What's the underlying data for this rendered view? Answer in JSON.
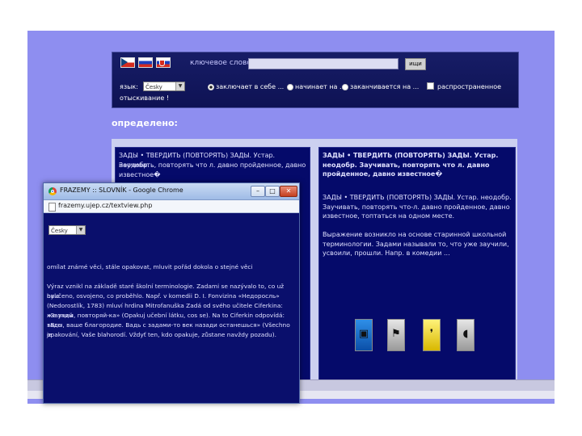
{
  "header": {
    "flags": [
      "czech-flag-icon",
      "russian-flag-icon",
      "slovak-flag-icon"
    ],
    "search_label": "ключевое слово:",
    "search_value": "",
    "search_button": "ищи",
    "language_label": "язык:",
    "language_value": "Česky",
    "options": [
      {
        "label": "заключает в себе ...",
        "selected": true
      },
      {
        "label": "начинает на ...",
        "selected": false
      },
      {
        "label": "заканчивается на ...",
        "selected": false
      }
    ],
    "extended_label": "распространенное",
    "extended_line2": "отыскивание !"
  },
  "result_heading": "определено:",
  "left_panel": {
    "line1": "ЗАДЫ • ТВЕРДИТЬ (ПОВТОРЯТЬ) ЗАДЫ. Устар. неодобр.",
    "line2": "Заучивать, повторять что л. давно пройденное, давно",
    "line3": "известное�"
  },
  "right_panel": {
    "title": "ЗАДЫ • ТВЕРДИТЬ (ПОВТОРЯТЬ) ЗАДЫ. Устар. неодобр. Заучивать, повторять что л. давно пройденное, давно известное�",
    "body": "ЗАДЫ • ТВЕРДИТЬ (ПОВТОРЯТЬ) ЗАДЫ. Устар. неодобр. Заучивать, повторять что-л. давно пройденное, давно известное, топтаться на одном месте.",
    "origin": "Выражение возникло на основе старинной школьной терминологии. Задами называли то, что уже заучили, усвоили, прошли. Напр. в комедии ...",
    "media": [
      "image-icon",
      "camera-icon",
      "speech-bubble-icon",
      "audio-icon"
    ]
  },
  "popup": {
    "window_title": "FRAZEMY :: SLOVNÍK - Google Chrome",
    "url": "frazemy.ujep.cz/textview.php",
    "language_value": "Česky",
    "meaning": "omílat známé věci, stále opakovat, mluvit pořád dokola o stejné věci",
    "origin_lines": [
      "Výraz vznikl na základě staré školní terminologie. Zadami se nazývalo to, co už bylo",
      "naučeno, osvojeno, co proběhlo. Např. v komedii D. I. Fonvizina «Недоросль»",
      "(Nedorostlík, 1783) mluví hrdina Mitrofanuška Zadá od svého učitele Ciferkina: «Заучий",
      "же зады, повторяй-ка» (Opakuj učební látku, cos se). Na to Ciferkin odpovídá: «Все",
      "зады, ваше благородие. Вадь с задами-то век назади останешься» (Všechno je",
      "opakování, Vaše blahorodí. Vždyť ten, kdo opakuje, zůstane navždy pozadu)."
    ]
  }
}
